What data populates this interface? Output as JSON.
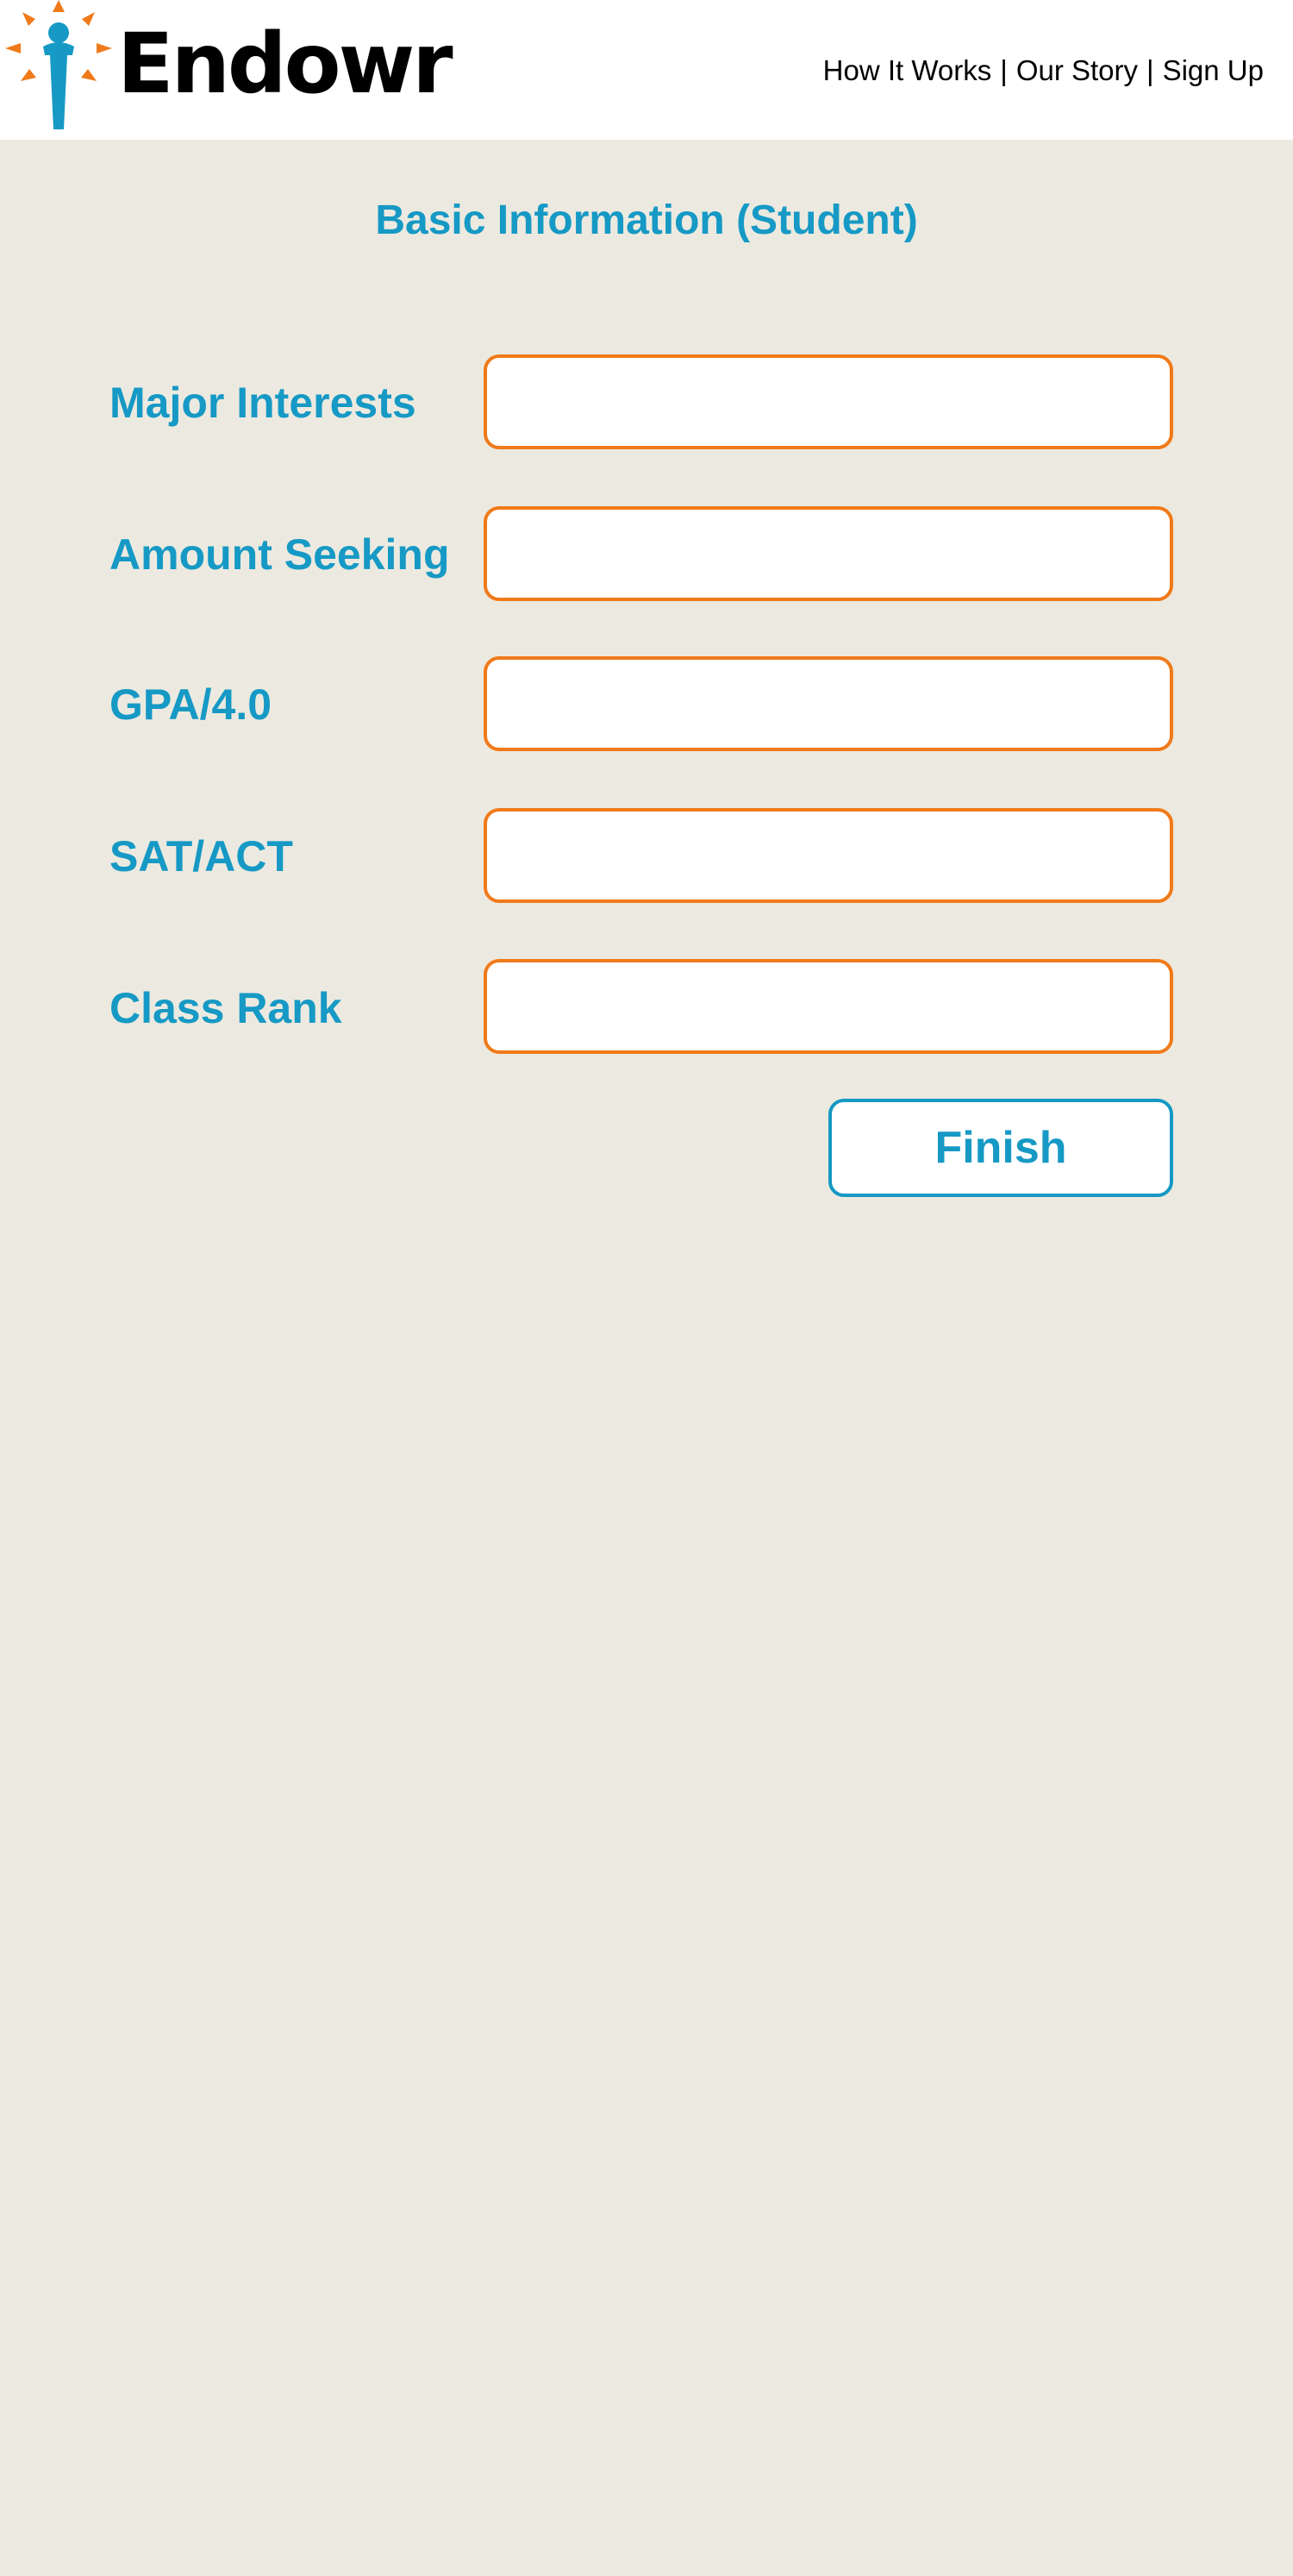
{
  "header": {
    "logo_icon": "torch-figure-icon",
    "brand": "Endowr",
    "nav": {
      "how_it_works": "How It Works",
      "our_story": "Our Story",
      "sign_up": "Sign Up",
      "separator": "|"
    }
  },
  "page": {
    "title": "Basic Information (Student)"
  },
  "form": {
    "fields": [
      {
        "label": "Major Interests",
        "value": ""
      },
      {
        "label": "Amount Seeking",
        "value": ""
      },
      {
        "label": "GPA/4.0",
        "value": ""
      },
      {
        "label": "SAT/ACT",
        "value": ""
      },
      {
        "label": "Class Rank",
        "value": ""
      }
    ],
    "finish_label": "Finish"
  },
  "colors": {
    "accent_blue": "#1699C5",
    "accent_orange": "#F07A1A",
    "background": "#ECEAE0",
    "header_bg": "#FFFFFF",
    "text_dark": "#000000"
  }
}
